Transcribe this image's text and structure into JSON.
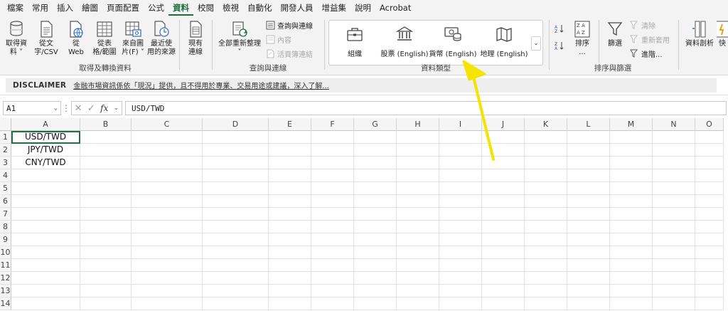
{
  "tabs": [
    "檔案",
    "常用",
    "插入",
    "繪圖",
    "頁面配置",
    "公式",
    "資料",
    "校閱",
    "檢視",
    "自動化",
    "開發人員",
    "增益集",
    "說明",
    "Acrobat"
  ],
  "active_tab_index": 6,
  "ribbon": {
    "get_transform": {
      "label": "取得及轉換資料",
      "buttons": [
        {
          "l1": "取得資",
          "l2": "料 ˅",
          "icon": "database-icon"
        },
        {
          "l1": "從文",
          "l2": "字/CSV",
          "icon": "text-file-icon"
        },
        {
          "l1": "從",
          "l2": "Web",
          "icon": "web-icon"
        },
        {
          "l1": "從表",
          "l2": "格/範圍",
          "icon": "table-icon"
        },
        {
          "l1": "來自圖",
          "l2": "片(F) ˅",
          "icon": "picture-table-icon"
        },
        {
          "l1": "最近使",
          "l2": "用的來源",
          "icon": "recent-sources-icon"
        },
        {
          "l1": "現有",
          "l2": "連線",
          "icon": "existing-connections-icon"
        }
      ]
    },
    "queries": {
      "label": "查詢與連線",
      "refresh_l1": "全部重新整理",
      "refresh_l2": "˅",
      "small": [
        "查詢與連線",
        "內容",
        "活頁簿連結"
      ]
    },
    "data_types": {
      "label": "資料類型",
      "items": [
        {
          "label": "組織",
          "icon": "briefcase-icon"
        },
        {
          "label": "股票 (English)",
          "icon": "bank-icon"
        },
        {
          "label": "貨幣 (English)",
          "icon": "currency-icon"
        },
        {
          "label": "地理 (English)",
          "icon": "map-icon"
        }
      ],
      "more": "⌄"
    },
    "sort_filter": {
      "label": "排序與篩選",
      "sort_l1": "排序",
      "sort_l2": "...",
      "filter": "篩選",
      "small": [
        "清除",
        "重新套用",
        "進階..."
      ]
    },
    "tools": {
      "split_label": "資料剖析",
      "quick_label": "快"
    }
  },
  "disclaimer": {
    "title": "DISCLAIMER",
    "text": "金融市場資訊係依「現況」提供，且不得用於專業、交易用途或建議，深入了解..."
  },
  "formula_bar": {
    "cell_ref": "A1",
    "dots": "⋮",
    "cancel": "✕",
    "enter": "✓",
    "fx": "fx",
    "formula": "USD/TWD"
  },
  "columns": [
    "A",
    "B",
    "C",
    "D",
    "E",
    "F",
    "G",
    "H",
    "I",
    "J",
    "K",
    "L",
    "M",
    "N",
    "O"
  ],
  "rows": [
    "1",
    "2",
    "3",
    "4",
    "5",
    "6",
    "7",
    "8",
    "9",
    "10",
    "11",
    "12",
    "13",
    "14"
  ],
  "cells": {
    "A1": "USD/TWD",
    "A2": "JPY/TWD",
    "A3": "CNY/TWD"
  },
  "colors": {
    "accent_green": "#1a6f3a",
    "selection_green": "#1e7145",
    "annotation_arrow": "#f5e400"
  }
}
